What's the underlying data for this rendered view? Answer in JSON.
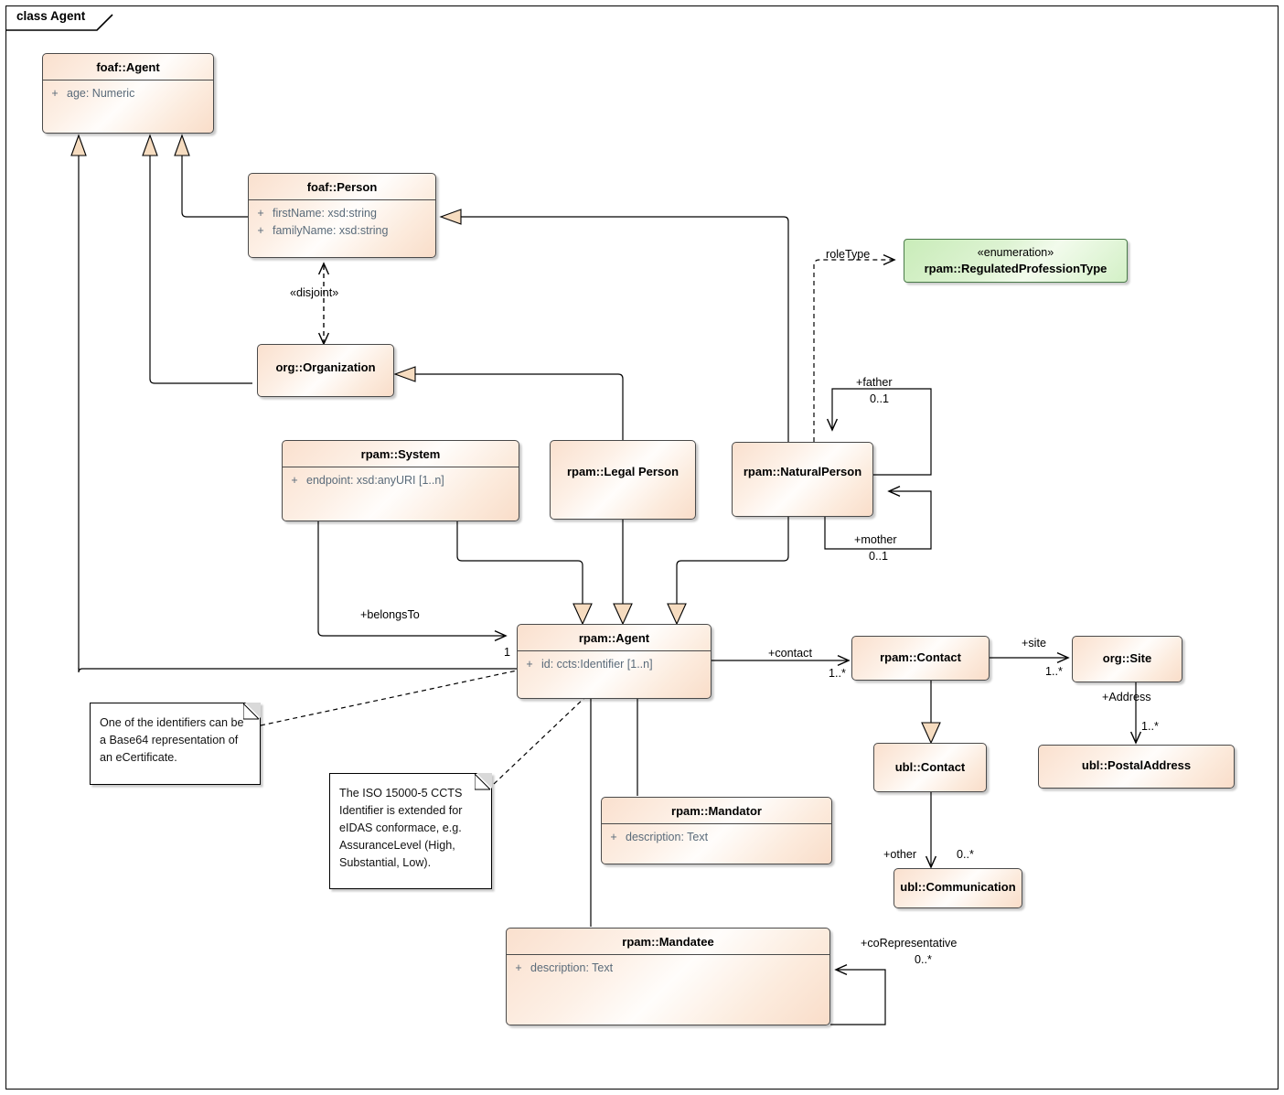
{
  "diagram": {
    "frame_title": "class Agent",
    "type": "uml-class-diagram"
  },
  "classes": [
    {
      "id": "foaf-agent",
      "name": "foaf::Agent",
      "attributes": [
        {
          "visibility": "+",
          "text": "age: Numeric"
        }
      ]
    },
    {
      "id": "foaf-person",
      "name": "foaf::Person",
      "attributes": [
        {
          "visibility": "+",
          "text": "firstName: xsd:string"
        },
        {
          "visibility": "+",
          "text": "familyName: xsd:string"
        }
      ]
    },
    {
      "id": "org-organization",
      "name": "org::Organization",
      "attributes": []
    },
    {
      "id": "rpam-system",
      "name": "rpam::System",
      "attributes": [
        {
          "visibility": "+",
          "text": "endpoint: xsd:anyURI [1..n]"
        }
      ]
    },
    {
      "id": "rpam-legal-person",
      "name": "rpam::Legal Person",
      "attributes": []
    },
    {
      "id": "rpam-naturalperson",
      "name": "rpam::NaturalPerson",
      "attributes": []
    },
    {
      "id": "rpam-agent",
      "name": "rpam::Agent",
      "attributes": [
        {
          "visibility": "+",
          "text": "id: ccts:Identifier [1..n]"
        }
      ]
    },
    {
      "id": "rpam-contact",
      "name": "rpam::Contact",
      "attributes": []
    },
    {
      "id": "org-site",
      "name": "org::Site",
      "attributes": []
    },
    {
      "id": "ubl-contact",
      "name": "ubl::Contact",
      "attributes": []
    },
    {
      "id": "ubl-postaladdress",
      "name": "ubl::PostalAddress",
      "attributes": []
    },
    {
      "id": "ubl-communication",
      "name": "ubl::Communication",
      "attributes": []
    },
    {
      "id": "rpam-mandator",
      "name": "rpam::Mandator",
      "attributes": [
        {
          "visibility": "+",
          "text": "description: Text"
        }
      ]
    },
    {
      "id": "rpam-mandatee",
      "name": "rpam::Mandatee",
      "attributes": [
        {
          "visibility": "+",
          "text": "description: Text"
        }
      ]
    }
  ],
  "enumerations": [
    {
      "id": "rpam-regulatedprofessiontype",
      "stereotype": "«enumeration»",
      "name": "rpam::RegulatedProfessionType"
    }
  ],
  "notes": [
    {
      "id": "note-ecertificate",
      "text": "One of the identifiers can be\na Base64 representation of\nan eCertificate."
    },
    {
      "id": "note-ccts",
      "text": "The ISO 15000-5 CCTS\nIdentifier is extended for\neIDAS conformace, e.g.\nAssuranceLevel (High,\nSubstantial, Low)."
    }
  ],
  "connector_labels": {
    "disjoint": "«disjoint»",
    "role_type": "roleType",
    "father": "+father",
    "father_mult": "0..1",
    "mother": "+mother",
    "mother_mult": "0..1",
    "belongs_to": "+belongsTo",
    "belongs_to_mult": "1",
    "contact": "+contact",
    "contact_mult": "1..*",
    "site": "+site",
    "site_mult": "1..*",
    "address": "+Address",
    "address_mult": "1..*",
    "other": "+other",
    "other_mult": "0..*",
    "co_representative": "+coRepresentative",
    "co_representative_mult": "0..*"
  },
  "colors": {
    "class_fill": "#fae0ce",
    "class_border": "#4a4a4a",
    "enum_fill": "#c9ecb9",
    "enum_border": "#4a7a4a",
    "attribute_text": "#5a6b7a",
    "line": "#000000",
    "note_fill": "#ffffff",
    "triangle_fill": "#f6dcc0"
  }
}
